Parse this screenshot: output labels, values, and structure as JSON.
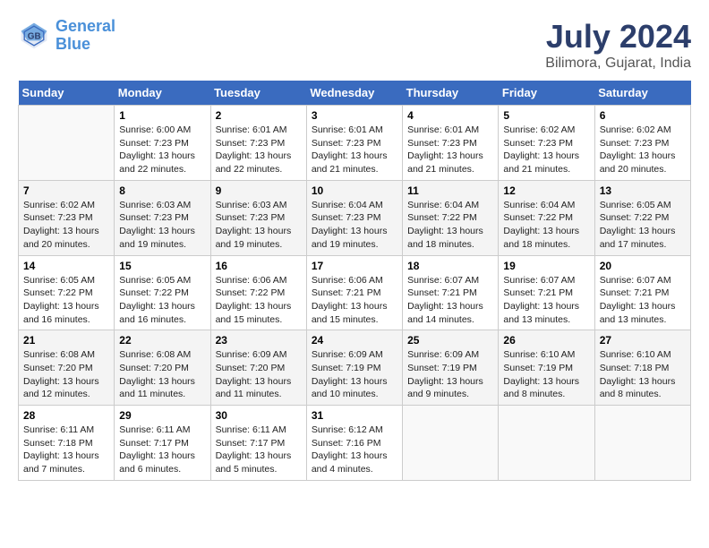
{
  "header": {
    "logo_line1": "General",
    "logo_line2": "Blue",
    "month_title": "July 2024",
    "location": "Bilimora, Gujarat, India"
  },
  "weekdays": [
    "Sunday",
    "Monday",
    "Tuesday",
    "Wednesday",
    "Thursday",
    "Friday",
    "Saturday"
  ],
  "weeks": [
    [
      {
        "num": "",
        "info": ""
      },
      {
        "num": "1",
        "info": "Sunrise: 6:00 AM\nSunset: 7:23 PM\nDaylight: 13 hours\nand 22 minutes."
      },
      {
        "num": "2",
        "info": "Sunrise: 6:01 AM\nSunset: 7:23 PM\nDaylight: 13 hours\nand 22 minutes."
      },
      {
        "num": "3",
        "info": "Sunrise: 6:01 AM\nSunset: 7:23 PM\nDaylight: 13 hours\nand 21 minutes."
      },
      {
        "num": "4",
        "info": "Sunrise: 6:01 AM\nSunset: 7:23 PM\nDaylight: 13 hours\nand 21 minutes."
      },
      {
        "num": "5",
        "info": "Sunrise: 6:02 AM\nSunset: 7:23 PM\nDaylight: 13 hours\nand 21 minutes."
      },
      {
        "num": "6",
        "info": "Sunrise: 6:02 AM\nSunset: 7:23 PM\nDaylight: 13 hours\nand 20 minutes."
      }
    ],
    [
      {
        "num": "7",
        "info": "Sunrise: 6:02 AM\nSunset: 7:23 PM\nDaylight: 13 hours\nand 20 minutes."
      },
      {
        "num": "8",
        "info": "Sunrise: 6:03 AM\nSunset: 7:23 PM\nDaylight: 13 hours\nand 19 minutes."
      },
      {
        "num": "9",
        "info": "Sunrise: 6:03 AM\nSunset: 7:23 PM\nDaylight: 13 hours\nand 19 minutes."
      },
      {
        "num": "10",
        "info": "Sunrise: 6:04 AM\nSunset: 7:23 PM\nDaylight: 13 hours\nand 19 minutes."
      },
      {
        "num": "11",
        "info": "Sunrise: 6:04 AM\nSunset: 7:22 PM\nDaylight: 13 hours\nand 18 minutes."
      },
      {
        "num": "12",
        "info": "Sunrise: 6:04 AM\nSunset: 7:22 PM\nDaylight: 13 hours\nand 18 minutes."
      },
      {
        "num": "13",
        "info": "Sunrise: 6:05 AM\nSunset: 7:22 PM\nDaylight: 13 hours\nand 17 minutes."
      }
    ],
    [
      {
        "num": "14",
        "info": "Sunrise: 6:05 AM\nSunset: 7:22 PM\nDaylight: 13 hours\nand 16 minutes."
      },
      {
        "num": "15",
        "info": "Sunrise: 6:05 AM\nSunset: 7:22 PM\nDaylight: 13 hours\nand 16 minutes."
      },
      {
        "num": "16",
        "info": "Sunrise: 6:06 AM\nSunset: 7:22 PM\nDaylight: 13 hours\nand 15 minutes."
      },
      {
        "num": "17",
        "info": "Sunrise: 6:06 AM\nSunset: 7:21 PM\nDaylight: 13 hours\nand 15 minutes."
      },
      {
        "num": "18",
        "info": "Sunrise: 6:07 AM\nSunset: 7:21 PM\nDaylight: 13 hours\nand 14 minutes."
      },
      {
        "num": "19",
        "info": "Sunrise: 6:07 AM\nSunset: 7:21 PM\nDaylight: 13 hours\nand 13 minutes."
      },
      {
        "num": "20",
        "info": "Sunrise: 6:07 AM\nSunset: 7:21 PM\nDaylight: 13 hours\nand 13 minutes."
      }
    ],
    [
      {
        "num": "21",
        "info": "Sunrise: 6:08 AM\nSunset: 7:20 PM\nDaylight: 13 hours\nand 12 minutes."
      },
      {
        "num": "22",
        "info": "Sunrise: 6:08 AM\nSunset: 7:20 PM\nDaylight: 13 hours\nand 11 minutes."
      },
      {
        "num": "23",
        "info": "Sunrise: 6:09 AM\nSunset: 7:20 PM\nDaylight: 13 hours\nand 11 minutes."
      },
      {
        "num": "24",
        "info": "Sunrise: 6:09 AM\nSunset: 7:19 PM\nDaylight: 13 hours\nand 10 minutes."
      },
      {
        "num": "25",
        "info": "Sunrise: 6:09 AM\nSunset: 7:19 PM\nDaylight: 13 hours\nand 9 minutes."
      },
      {
        "num": "26",
        "info": "Sunrise: 6:10 AM\nSunset: 7:19 PM\nDaylight: 13 hours\nand 8 minutes."
      },
      {
        "num": "27",
        "info": "Sunrise: 6:10 AM\nSunset: 7:18 PM\nDaylight: 13 hours\nand 8 minutes."
      }
    ],
    [
      {
        "num": "28",
        "info": "Sunrise: 6:11 AM\nSunset: 7:18 PM\nDaylight: 13 hours\nand 7 minutes."
      },
      {
        "num": "29",
        "info": "Sunrise: 6:11 AM\nSunset: 7:17 PM\nDaylight: 13 hours\nand 6 minutes."
      },
      {
        "num": "30",
        "info": "Sunrise: 6:11 AM\nSunset: 7:17 PM\nDaylight: 13 hours\nand 5 minutes."
      },
      {
        "num": "31",
        "info": "Sunrise: 6:12 AM\nSunset: 7:16 PM\nDaylight: 13 hours\nand 4 minutes."
      },
      {
        "num": "",
        "info": ""
      },
      {
        "num": "",
        "info": ""
      },
      {
        "num": "",
        "info": ""
      }
    ]
  ]
}
